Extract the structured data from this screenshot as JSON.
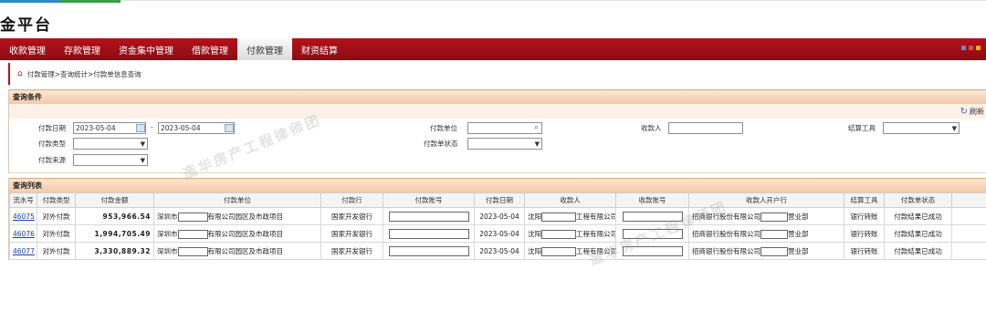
{
  "app": {
    "title": "金平台"
  },
  "nav": {
    "items": [
      {
        "label": "收款管理"
      },
      {
        "label": "存款管理"
      },
      {
        "label": "资金集中管理"
      },
      {
        "label": "借款管理"
      },
      {
        "label": "付款管理",
        "active": true
      },
      {
        "label": "财资结算"
      }
    ],
    "indicator_colors": [
      "#5b8fd6",
      "#d94b4b",
      "#f0b400"
    ]
  },
  "breadcrumb": {
    "text": "付款管理>查询统计>付款单信息查询"
  },
  "query": {
    "title": "查询条件",
    "refresh_label": "刷新",
    "pay_date_label": "付款日期",
    "pay_date_from": "2023-05-04",
    "range_sep": "-",
    "pay_date_to": "2023-05-04",
    "pay_unit_label": "付款单位",
    "payee_label": "收款人",
    "settle_tool_label": "结算工具",
    "pay_type_label": "付款类型",
    "status_label": "付款单状态",
    "source_label": "付款来源"
  },
  "list": {
    "title": "查询列表",
    "columns": [
      "流水号",
      "付款类型",
      "付款金额",
      "付款单位",
      "付款行",
      "付款账号",
      "付款日期",
      "收款人",
      "收款账号",
      "收款人开户行",
      "结算工具",
      "付款单状态"
    ],
    "rows": [
      {
        "serial": "46075",
        "type": "对外付款",
        "amount": "953,966.54",
        "unit_prefix": "深圳市",
        "unit_suffix": "有限公司园区及市政项目",
        "bank": "国家开发银行",
        "date": "2023-05-04",
        "payee_prefix": "沈阳",
        "payee_suffix": "工程有限公司",
        "payee_bank_prefix": "招商银行股份有限公司",
        "payee_bank_suffix": "营业部",
        "tool": "银行转账",
        "status": "付款结果已成功"
      },
      {
        "serial": "46076",
        "type": "对外付款",
        "amount": "1,994,705.49",
        "unit_prefix": "深圳市",
        "unit_suffix": "有限公司园区及市政项目",
        "bank": "国家开发银行",
        "date": "2023-05-04",
        "payee_prefix": "沈阳",
        "payee_suffix": "工程有限公司",
        "payee_bank_prefix": "招商银行股份有限公司",
        "payee_bank_suffix": "营业部",
        "tool": "银行转账",
        "status": "付款结果已成功"
      },
      {
        "serial": "46077",
        "type": "对外付款",
        "amount": "3,330,889.32",
        "unit_prefix": "深圳市",
        "unit_suffix": "有限公司园区及市政项目",
        "bank": "国家开发银行",
        "date": "2023-05-04",
        "payee_prefix": "沈阳",
        "payee_suffix": "工程有限公司",
        "payee_bank_prefix": "招商银行股份有限公司",
        "payee_bank_suffix": "营业部",
        "tool": "银行转账",
        "status": "付款结果已成功"
      }
    ]
  },
  "watermark": {
    "text": "造华房产工程律师团"
  }
}
